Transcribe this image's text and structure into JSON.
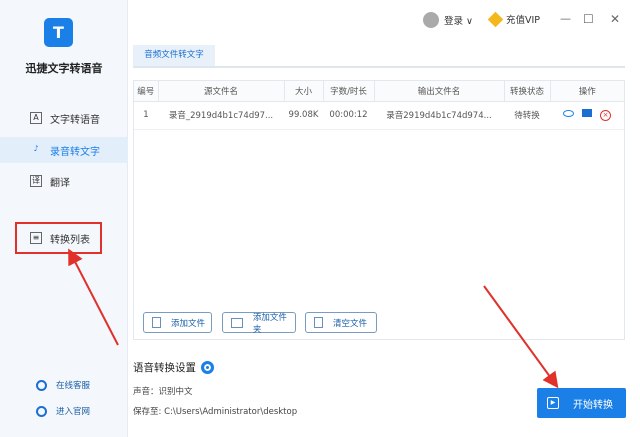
{
  "app": {
    "name": "迅捷文字转语音",
    "logo_text": "T"
  },
  "sidebar": {
    "items": [
      {
        "label": "文字转语音",
        "icon": "A"
      },
      {
        "label": "录音转文字",
        "icon": "♪"
      },
      {
        "label": "翻译",
        "icon": "译"
      },
      {
        "label": "转换列表",
        "icon": "≡"
      }
    ],
    "footer": [
      {
        "label": "在线客服"
      },
      {
        "label": "进入官网"
      }
    ]
  },
  "topbar": {
    "login": "登录 ∨",
    "vip": "充值VIP",
    "minimize": "—",
    "maximize": "☐",
    "close": "✕"
  },
  "tab": "音频文件转文字",
  "table": {
    "headers": [
      "编号",
      "源文件名",
      "大小",
      "字数/时长",
      "输出文件名",
      "转换状态",
      "操作"
    ],
    "rows": [
      {
        "no": "1",
        "source": "录音_2919d4b1c74d97...",
        "size": "99.08K",
        "duration": "00:00:12",
        "output": "录音2919d4b1c74d974...",
        "status": "待转换"
      }
    ]
  },
  "buttons": {
    "add_file": "添加文件",
    "add_folder": "添加文件夹",
    "clear": "清空文件"
  },
  "settings": {
    "title": "语音转换设置",
    "voice": "声音：识别中文",
    "save_to": "保存至: C:\\Users\\Administrator\\desktop"
  },
  "start_button": "开始转换",
  "colors": {
    "accent": "#1a7fe6",
    "annotation": "#e0312b"
  }
}
